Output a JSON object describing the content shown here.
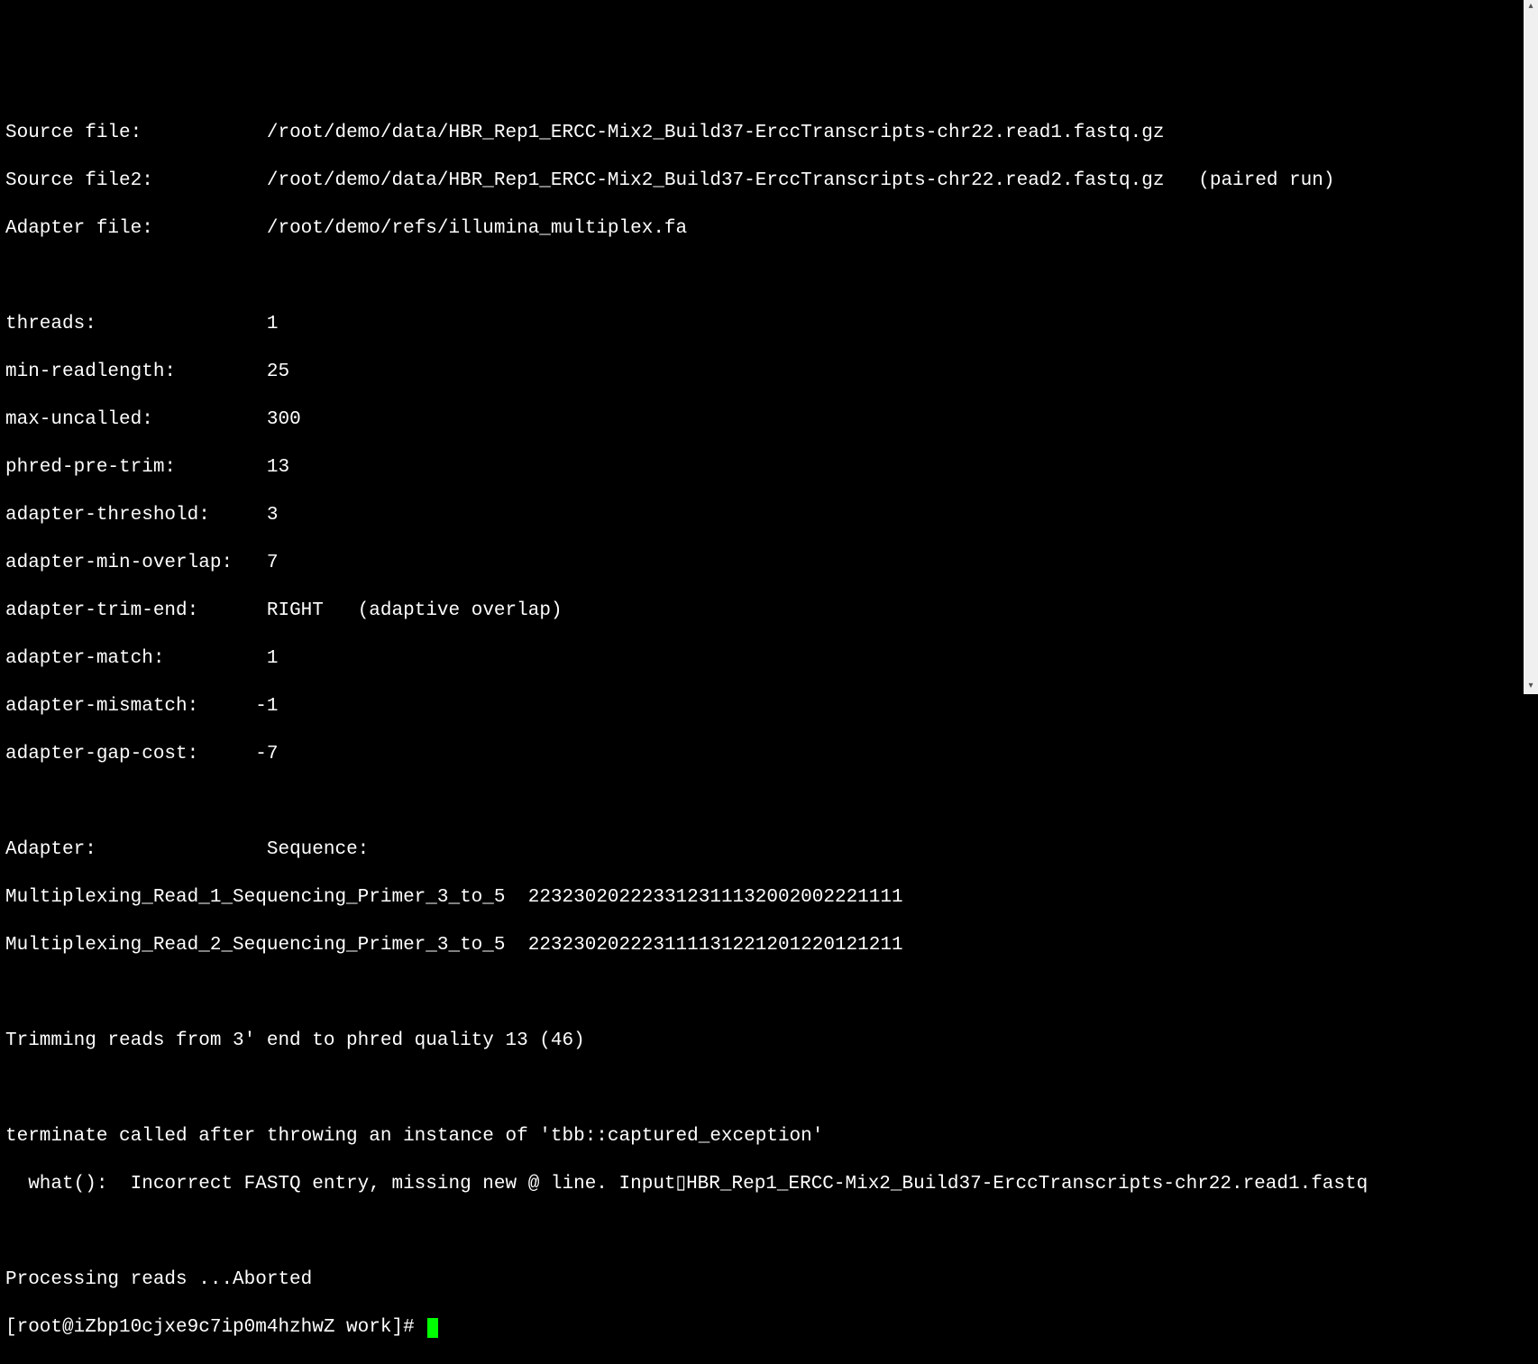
{
  "header": {
    "source_file_label": "Source file:",
    "source_file_value": "/root/demo/data/HBR_Rep1_ERCC-Mix2_Build37-ErccTranscripts-chr22.read1.fastq.gz",
    "source_file2_label": "Source file2:",
    "source_file2_value": "/root/demo/data/HBR_Rep1_ERCC-Mix2_Build37-ErccTranscripts-chr22.read2.fastq.gz",
    "source_file2_note": "(paired run)",
    "adapter_file_label": "Adapter file:",
    "adapter_file_value": "/root/demo/refs/illumina_multiplex.fa"
  },
  "params": {
    "threads_label": "threads:",
    "threads_value": "1",
    "min_readlength_label": "min-readlength:",
    "min_readlength_value": "25",
    "max_uncalled_label": "max-uncalled:",
    "max_uncalled_value": "300",
    "phred_pre_trim_label": "phred-pre-trim:",
    "phred_pre_trim_value": "13",
    "adapter_threshold_label": "adapter-threshold:",
    "adapter_threshold_value": "3",
    "adapter_min_overlap_label": "adapter-min-overlap:",
    "adapter_min_overlap_value": "7",
    "adapter_trim_end_label": "adapter-trim-end:",
    "adapter_trim_end_value": "RIGHT",
    "adapter_trim_end_note": "(adaptive overlap)",
    "adapter_match_label": "adapter-match:",
    "adapter_match_value": "1",
    "adapter_mismatch_label": "adapter-mismatch:",
    "adapter_mismatch_value": "-1",
    "adapter_gap_cost_label": "adapter-gap-cost:",
    "adapter_gap_cost_value": "-7"
  },
  "adapters": {
    "header_adapter": "Adapter:",
    "header_sequence": "Sequence:",
    "row1_name": "Multiplexing_Read_1_Sequencing_Primer_3_to_5",
    "row1_seq": "223230202223312311132002002221111",
    "row2_name": "Multiplexing_Read_2_Sequencing_Primer_3_to_5",
    "row2_seq": "223230202223111131221201220121211"
  },
  "messages": {
    "trimming": "Trimming reads from 3' end to phred quality 13 (46)",
    "terminate": "terminate called after throwing an instance of 'tbb::captured_exception'",
    "what": "  what():  Incorrect FASTQ entry, missing new @ line. Input▯HBR_Rep1_ERCC-Mix2_Build37-ErccTranscripts-chr22.read1.fastq",
    "processing": "Processing reads ...Aborted"
  },
  "prompt": {
    "text": "[root@iZbp10cjxe9c7ip0m4hzhwZ work]# "
  }
}
